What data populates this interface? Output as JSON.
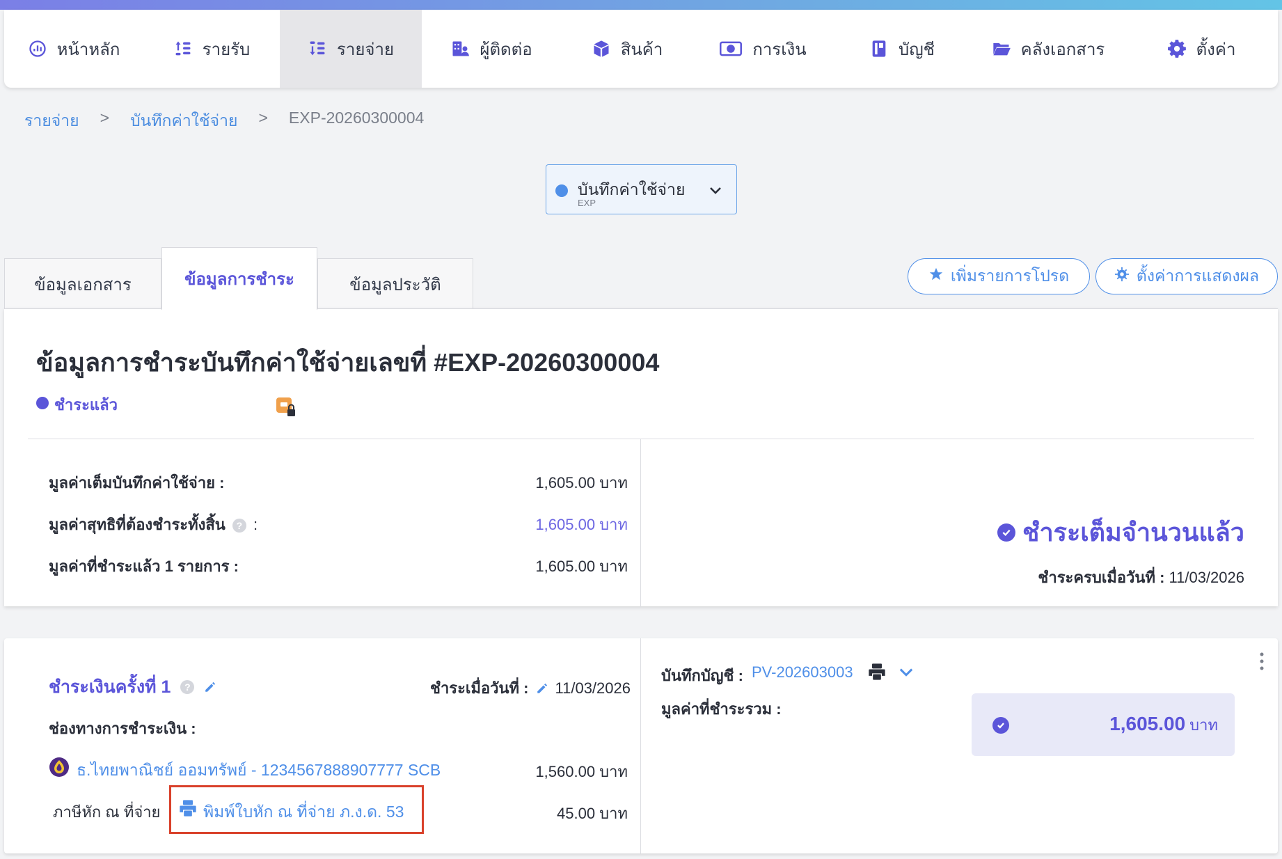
{
  "nav": {
    "items": [
      {
        "label": "หน้าหลัก",
        "icon": "chart-icon"
      },
      {
        "label": "รายรับ",
        "icon": "coins-in-icon"
      },
      {
        "label": "รายจ่าย",
        "icon": "coins-out-icon",
        "active": true
      },
      {
        "label": "ผู้ติดต่อ",
        "icon": "contacts-icon"
      },
      {
        "label": "สินค้า",
        "icon": "box-icon"
      },
      {
        "label": "การเงิน",
        "icon": "money-icon"
      },
      {
        "label": "บัญชี",
        "icon": "ledger-icon"
      },
      {
        "label": "คลังเอกสาร",
        "icon": "folder-icon"
      },
      {
        "label": "ตั้งค่า",
        "icon": "gear-icon"
      }
    ]
  },
  "breadcrumb": {
    "level1": "รายจ่าย",
    "level2": "บันทึกค่าใช้จ่าย",
    "current": "EXP-20260300004",
    "sep": ">"
  },
  "doctype": {
    "label": "บันทึกค่าใช้จ่าย",
    "code": "EXP"
  },
  "tabs": [
    {
      "label": "ข้อมูลเอกสาร"
    },
    {
      "label": "ข้อมูลการชำระ",
      "active": true
    },
    {
      "label": "ข้อมูลประวัติ"
    }
  ],
  "actions": {
    "favorite": "เพิ่มรายการโปรด",
    "display_settings": "ตั้งค่าการแสดงผล"
  },
  "summary": {
    "title": "ข้อมูลการชำระบันทึกค่าใช้จ่ายเลขที่ #EXP-20260300004",
    "status": "ชำระแล้ว",
    "full_value_label": "มูลค่าเต็มบันทึกค่าใช้จ่าย :",
    "full_value": "1,605.00 บาท",
    "net_label": "มูลค่าสุทธิที่ต้องชำระทั้งสิ้น",
    "net_colon": ":",
    "net_value": "1,605.00 บาท",
    "paid_label": "มูลค่าที่ชำระแล้ว 1 รายการ :",
    "paid_value": "1,605.00 บาท",
    "paid_full": "ชำระเต็มจำนวนแล้ว",
    "paid_date_label": "ชำระครบเมื่อวันที่ :",
    "paid_date": "11/03/2026"
  },
  "payment": {
    "title": "ชำระเงินครั้งที่ 1",
    "date_label": "ชำระเมื่อวันที่ :",
    "date": "11/03/2026",
    "channel_label": "ช่องทางการชำระเงิน :",
    "bank": "ธ.ไทยพาณิชย์ ออมทรัพย์ - 1234567888907777 SCB",
    "bank_amount": "1,560.00 บาท",
    "wht_label": "ภาษีหัก ณ ที่จ่าย",
    "wht_link": "พิมพ์ใบหัก ณ ที่จ่าย ภ.ง.ด. 53",
    "wht_amount": "45.00 บาท",
    "account_label": "บันทึกบัญชี :",
    "account_link": "PV-202603003",
    "total_label": "มูลค่าที่ชำระรวม :",
    "total_amount": "1,605.00",
    "total_unit": "บาท"
  },
  "colors": {
    "accent": "#5b55d9",
    "link": "#4f8fe8",
    "highlight": "#d9412b"
  }
}
